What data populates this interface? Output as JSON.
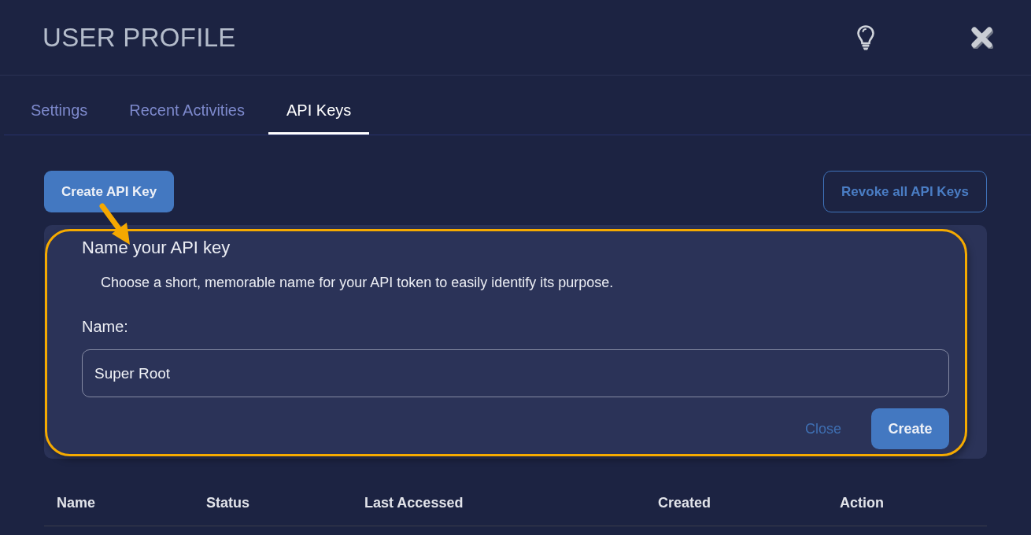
{
  "header": {
    "title": "USER PROFILE"
  },
  "tabs": [
    {
      "label": "Settings",
      "selected": false
    },
    {
      "label": "Recent Activities",
      "selected": false
    },
    {
      "label": "API Keys",
      "selected": true
    }
  ],
  "actions": {
    "create_button": "Create API Key",
    "revoke_button": "Revoke all API Keys"
  },
  "form": {
    "highlighted": true,
    "title": "Name your API key",
    "description": "Choose a short, memorable name for your API token to easily identify its purpose.",
    "name_label": "Name:",
    "name_value": "Super Root",
    "close_button": "Close",
    "create_button": "Create"
  },
  "table": {
    "columns": [
      "Name",
      "Status",
      "Last Accessed",
      "Created",
      "Action"
    ]
  }
}
